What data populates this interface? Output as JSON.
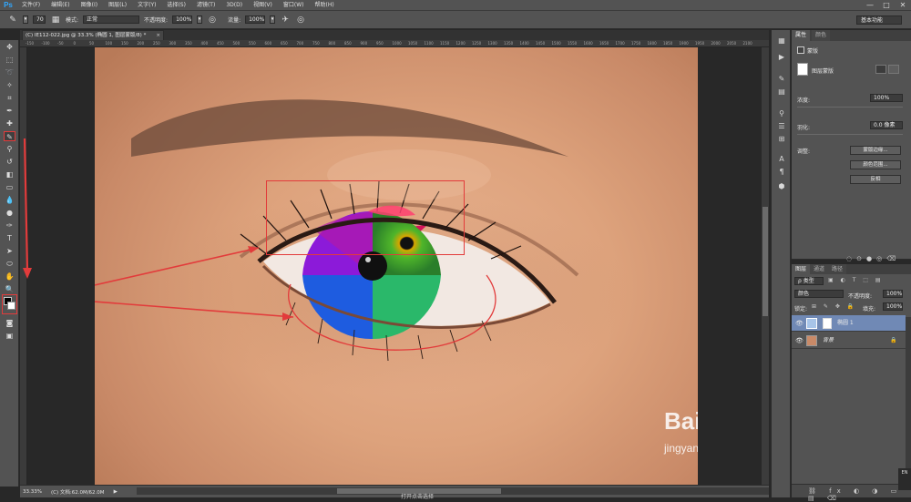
{
  "app": {
    "logo": "Ps"
  },
  "menu": [
    "文件(F)",
    "编辑(E)",
    "图像(I)",
    "图层(L)",
    "文字(Y)",
    "选择(S)",
    "滤镜(T)",
    "3D(D)",
    "视图(V)",
    "窗口(W)",
    "帮助(H)"
  ],
  "window_controls": [
    "—",
    "□",
    "✕"
  ],
  "options": {
    "brush_size": "70",
    "mode_label": "模式:",
    "mode_value": "正常",
    "opacity_label": "不透明度:",
    "opacity_value": "100%",
    "flow_label": "流量:",
    "flow_value": "100%",
    "workspace": "基本功能"
  },
  "document": {
    "tab_title": "(C) IE112-022.jpg @ 33.3% (椭圆 1, 图层蒙版/8) *",
    "tab_close": "×"
  },
  "ruler_ticks_top": [
    "-150",
    "-100",
    "-50",
    "0",
    "50",
    "100",
    "150",
    "200",
    "250",
    "300",
    "350",
    "400",
    "450",
    "500",
    "550",
    "600",
    "650",
    "700",
    "750",
    "800",
    "850",
    "900",
    "950",
    "1000",
    "1050",
    "1100",
    "1150",
    "1200",
    "1250",
    "1300",
    "1350",
    "1400",
    "1450",
    "1500",
    "1550",
    "1600",
    "1650",
    "1700",
    "1750",
    "1800",
    "1850",
    "1900",
    "1950",
    "2000",
    "2050",
    "2100"
  ],
  "status": {
    "zoom": "33.33%",
    "doc_info": "(C) 文档:62.0M/62.0M",
    "arrow": "▶"
  },
  "properties": {
    "tabs": [
      "属性",
      "颜色"
    ],
    "header": "蒙版",
    "layer_mask_label": "图层蒙版",
    "density_label": "浓度:",
    "density_value": "100%",
    "feather_label": "羽化:",
    "feather_value": "0.0 像素",
    "adjust_label": "调整:",
    "btn_mask_edge": "蒙版边缘...",
    "btn_color_range": "颜色范围...",
    "btn_invert": "反相"
  },
  "layers": {
    "tabs": [
      "图层",
      "通道",
      "路径"
    ],
    "filter_kind": "ρ 类型",
    "blend_mode": "颜色",
    "opacity_label": "不透明度:",
    "opacity_value": "100%",
    "lock_label": "锁定:",
    "fill_label": "填充:",
    "fill_value": "100%",
    "items": [
      {
        "name": "椭圆 1",
        "selected": true
      },
      {
        "name": "背景",
        "selected": false
      }
    ]
  },
  "watermark": {
    "brand": "Bai  经验",
    "url": "jingyan.baidu.com"
  },
  "bottom_text": "打开点击选择",
  "ime": "EN"
}
